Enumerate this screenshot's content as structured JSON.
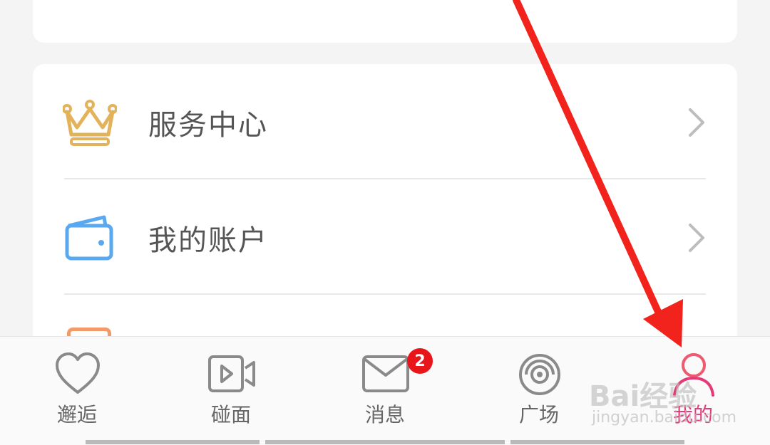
{
  "menu": {
    "items": [
      {
        "label": "服务中心",
        "icon": "crown-icon"
      },
      {
        "label": "我的账户",
        "icon": "wallet-icon"
      }
    ]
  },
  "tabbar": {
    "tabs": [
      {
        "label": "邂逅",
        "icon": "heart-icon",
        "active": false
      },
      {
        "label": "碰面",
        "icon": "video-icon",
        "active": false
      },
      {
        "label": "消息",
        "icon": "mail-icon",
        "active": false,
        "badge": "2"
      },
      {
        "label": "广场",
        "icon": "orbit-icon",
        "active": false
      },
      {
        "label": "我的",
        "icon": "user-icon",
        "active": true
      }
    ]
  },
  "watermark": {
    "brand": "Bai经验",
    "url": "jingyan.baidu.com"
  },
  "colors": {
    "accent": "#e33a78",
    "badge": "#e8161b",
    "arrow": "#f2221c",
    "crown": "#e3b35c",
    "wallet": "#5aa9f0"
  }
}
